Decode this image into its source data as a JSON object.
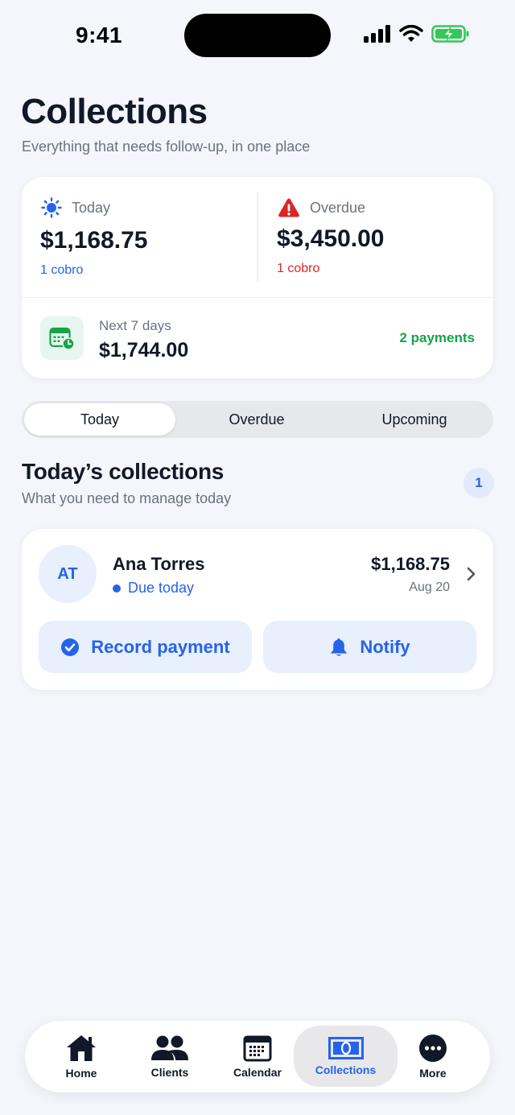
{
  "status_bar": {
    "time": "9:41"
  },
  "header": {
    "title": "Collections",
    "subtitle": "Everything that needs follow-up, in one place"
  },
  "summary": {
    "today": {
      "label": "Today",
      "amount": "$1,168.75",
      "sub": "1 cobro",
      "icon": "sun-icon",
      "color": "#2563eb"
    },
    "overdue": {
      "label": "Overdue",
      "amount": "$3,450.00",
      "sub": "1 cobro",
      "icon": "warning-icon",
      "color": "#dc2626"
    },
    "next": {
      "label": "Next 7 days",
      "amount": "$1,744.00",
      "count": "2 payments",
      "icon": "calendar-clock-icon",
      "color": "#16a34a"
    }
  },
  "segments": [
    "Today",
    "Overdue",
    "Upcoming"
  ],
  "selected_segment": "Today",
  "section": {
    "title": "Today’s collections",
    "subtitle": "What you need to manage today",
    "count": "1"
  },
  "collection": {
    "initials": "AT",
    "name": "Ana Torres",
    "status": "Due today",
    "amount": "$1,168.75",
    "date": "Aug 20",
    "record_label": "Record payment",
    "notify_label": "Notify"
  },
  "tabs": [
    {
      "label": "Home",
      "icon": "home-icon"
    },
    {
      "label": "Clients",
      "icon": "clients-icon"
    },
    {
      "label": "Calendar",
      "icon": "calendar-icon"
    },
    {
      "label": "Collections",
      "icon": "collections-icon"
    },
    {
      "label": "More",
      "icon": "more-icon"
    }
  ],
  "active_tab": "Collections",
  "colors": {
    "accent": "#2563eb",
    "danger": "#dc2626",
    "success": "#16a34a",
    "background": "#f4f6fb"
  }
}
